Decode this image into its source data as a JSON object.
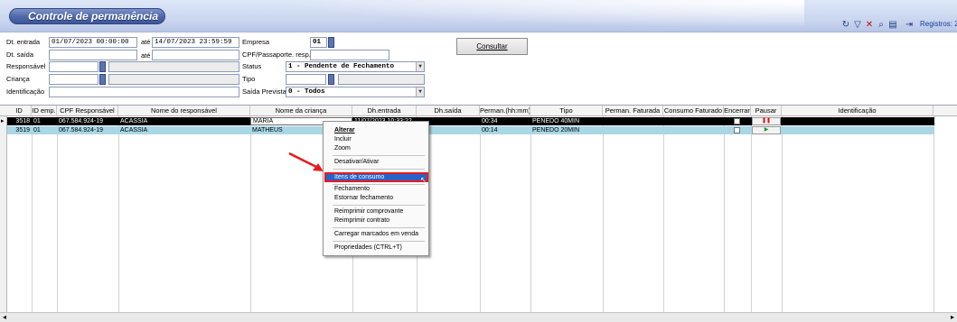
{
  "window": {
    "title": "Controle de permanência"
  },
  "toolbar": {
    "icons": [
      "refresh-icon",
      "filter-icon",
      "clear-filter-icon",
      "zoom-icon",
      "print-icon",
      "export-icon"
    ],
    "registros": "Registros: 2"
  },
  "filters": {
    "dt_entrada_label": "Dt. entrada",
    "dt_entrada_from": "01/07/2023 00:00:00",
    "ate1": "até",
    "dt_entrada_to": "14/07/2023 23:59:59",
    "dt_saida_label": "Dt. saída",
    "dt_saida_from": "",
    "ate2": "até",
    "dt_saida_to": "",
    "responsavel_label": "Responsável",
    "responsavel_code": "",
    "responsavel_name": "",
    "crianca_label": "Criança",
    "crianca_code": "",
    "crianca_name": "",
    "identificacao_label": "Identificação",
    "identificacao_value": "",
    "empresa_label": "Empresa",
    "empresa_value": "01",
    "cpf_label": "CPF/Passaporte. resp.",
    "cpf_value": "",
    "status_label": "Status",
    "status_value": "1 - Pendente de Fechamento",
    "tipo_label": "Tipo",
    "tipo_code": "",
    "tipo_name": "",
    "saida_prevista_label": "Saída Prevista",
    "saida_prevista_value": "0 - Todos",
    "consultar": "Consultar"
  },
  "grid": {
    "columns": [
      "ID",
      "ID emp.",
      "CPF Responsável",
      "Nome do responsável",
      "Nome da criança",
      "Dh.entrada",
      "Dh.saída",
      "Perman.(hh:mm)",
      "Tipo",
      "Perman. Faturada",
      "Consumo Faturado",
      "Encerrar",
      "Pausar",
      "Identificação"
    ],
    "rows": [
      {
        "id": "3518",
        "id_emp": "01",
        "cpf": "067.584.924-19",
        "responsavel": "ACASSIA",
        "crianca": "MARIA",
        "dh_entrada": "11/07/2023 10:33:22",
        "dh_saida": "",
        "perman": "00:34",
        "tipo": "PENEDO 40MIN",
        "perman_faturada": "",
        "consumo_faturado": "",
        "pausar_icon": "pause-icon"
      },
      {
        "id": "3519",
        "id_emp": "01",
        "cpf": "067.584.924-19",
        "responsavel": "ACASSIA",
        "crianca": "MATHEUS",
        "dh_entrada": "",
        "dh_saida": "",
        "perman": "00:14",
        "tipo": "PENEDO 20MIN",
        "perman_faturada": "",
        "consumo_faturado": "",
        "pausar_icon": "play-icon"
      }
    ]
  },
  "context_menu": {
    "items": [
      "Alterar",
      "Incluir",
      "Zoom",
      "Desativar/Ativar",
      "Itens de consumo",
      "Fechamento",
      "Estornar fechamento",
      "Reimprimir comprovante",
      "Reimprimir contrato",
      "Carregar marcados em venda",
      "Propriedades (CTRL+T)"
    ],
    "highlighted": "Itens de consumo"
  },
  "colors": {
    "selected_row": "#000000",
    "second_row": "#a9d7e6",
    "menu_highlight": "#2a63c8",
    "annotation": "#e81a1a"
  }
}
